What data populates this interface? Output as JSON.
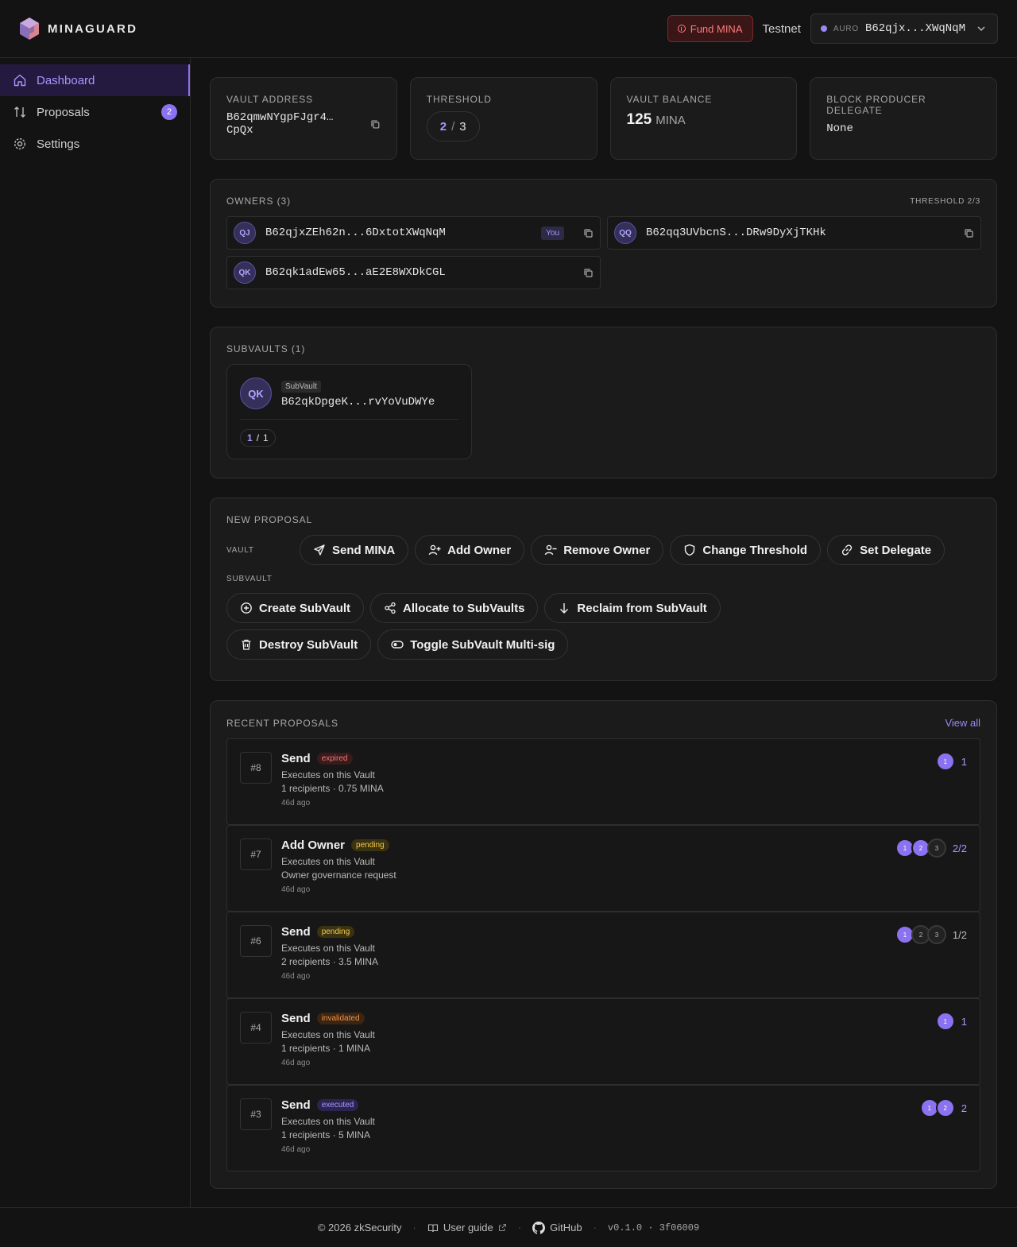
{
  "app": {
    "name": "MINAGUARD"
  },
  "header": {
    "fund_label": "Fund MINA",
    "network": "Testnet",
    "wallet_name": "AURO",
    "wallet_address": "B62qjx...XWqNqM"
  },
  "sidebar": {
    "items": [
      {
        "label": "Dashboard",
        "icon": "home-icon",
        "active": true
      },
      {
        "label": "Proposals",
        "icon": "arrows-up-down-icon",
        "badge": "2"
      },
      {
        "label": "Settings",
        "icon": "gear-icon"
      }
    ]
  },
  "stats": {
    "vault_address": {
      "label": "Vault Address",
      "value": "B62qmwNYgpFJgr4… CpQx"
    },
    "threshold": {
      "label": "Threshold",
      "current": "2",
      "sep": "/",
      "total": "3"
    },
    "balance": {
      "label": "Vault Balance",
      "amount": "125",
      "unit": "MINA"
    },
    "delegate": {
      "label": "Block Producer Delegate",
      "value": "None"
    }
  },
  "owners": {
    "title": "Owners (3)",
    "threshold_label": "THRESHOLD 2/3",
    "list": [
      {
        "initials": "QJ",
        "address": "B62qjxZEh62n...6DxtotXWqNqM",
        "you": "You"
      },
      {
        "initials": "QQ",
        "address": "B62qq3UVbcnS...DRw9DyXjTKHk"
      },
      {
        "initials": "QK",
        "address": "B62qk1adEw65...aE2E8WXDkCGL"
      }
    ]
  },
  "subvaults": {
    "title": "Subvaults (1)",
    "items": [
      {
        "initials": "QK",
        "tag": "SubVault",
        "address": "B62qkDpgeK...rvYoVuDWYe",
        "threshold_current": "1",
        "sep": "/",
        "threshold_total": "1"
      }
    ]
  },
  "new_proposal": {
    "title": "New Proposal",
    "vault_label": "VAULT",
    "subvault_label": "SUBVAULT",
    "vault_actions": [
      {
        "label": "Send MINA",
        "icon": "send-icon"
      },
      {
        "label": "Add Owner",
        "icon": "user-plus-icon"
      },
      {
        "label": "Remove Owner",
        "icon": "user-minus-icon"
      },
      {
        "label": "Change Threshold",
        "icon": "shield-icon"
      },
      {
        "label": "Set Delegate",
        "icon": "link-icon"
      }
    ],
    "subvault_actions": [
      {
        "label": "Create SubVault",
        "icon": "plus-circle-icon"
      },
      {
        "label": "Allocate to SubVaults",
        "icon": "share-icon"
      },
      {
        "label": "Reclaim from SubVault",
        "icon": "arrow-down-icon"
      },
      {
        "label": "Destroy SubVault",
        "icon": "trash-icon"
      },
      {
        "label": "Toggle SubVault Multi-sig",
        "icon": "toggle-icon"
      }
    ]
  },
  "recent": {
    "title": "Recent Proposals",
    "view_all": "View all",
    "items": [
      {
        "id": "#8",
        "title": "Send",
        "status": "expired",
        "line1": "Executes on this Vault",
        "line2": "1 recipients · 0.75 MINA",
        "time": "46d ago",
        "signers": [
          {
            "n": "1",
            "on": true
          }
        ],
        "count": "1",
        "done": true
      },
      {
        "id": "#7",
        "title": "Add Owner",
        "status": "pending",
        "line1": "Executes on this Vault",
        "line2": "Owner governance request",
        "time": "46d ago",
        "signers": [
          {
            "n": "1",
            "on": true
          },
          {
            "n": "2",
            "on": true
          },
          {
            "n": "3",
            "on": false
          }
        ],
        "count": "2/2",
        "done": true
      },
      {
        "id": "#6",
        "title": "Send",
        "status": "pending",
        "line1": "Executes on this Vault",
        "line2": "2 recipients · 3.5 MINA",
        "time": "46d ago",
        "signers": [
          {
            "n": "1",
            "on": true
          },
          {
            "n": "2",
            "on": false
          },
          {
            "n": "3",
            "on": false
          }
        ],
        "count": "1/2",
        "done": false
      },
      {
        "id": "#4",
        "title": "Send",
        "status": "invalidated",
        "line1": "Executes on this Vault",
        "line2": "1 recipients · 1 MINA",
        "time": "46d ago",
        "signers": [
          {
            "n": "1",
            "on": true
          }
        ],
        "count": "1",
        "done": true
      },
      {
        "id": "#3",
        "title": "Send",
        "status": "executed",
        "line1": "Executes on this Vault",
        "line2": "1 recipients · 5 MINA",
        "time": "46d ago",
        "signers": [
          {
            "n": "1",
            "on": true
          },
          {
            "n": "2",
            "on": true
          }
        ],
        "count": "2",
        "done": true
      }
    ]
  },
  "footer": {
    "copyright": "© 2026 zkSecurity",
    "guide": "User guide",
    "github": "GitHub",
    "version": "v0.1.0 · 3f06009"
  },
  "colors": {
    "accent": "#8b72f0",
    "background": "#131313",
    "card": "#1b1b1b",
    "danger": "#ff7a7a"
  }
}
